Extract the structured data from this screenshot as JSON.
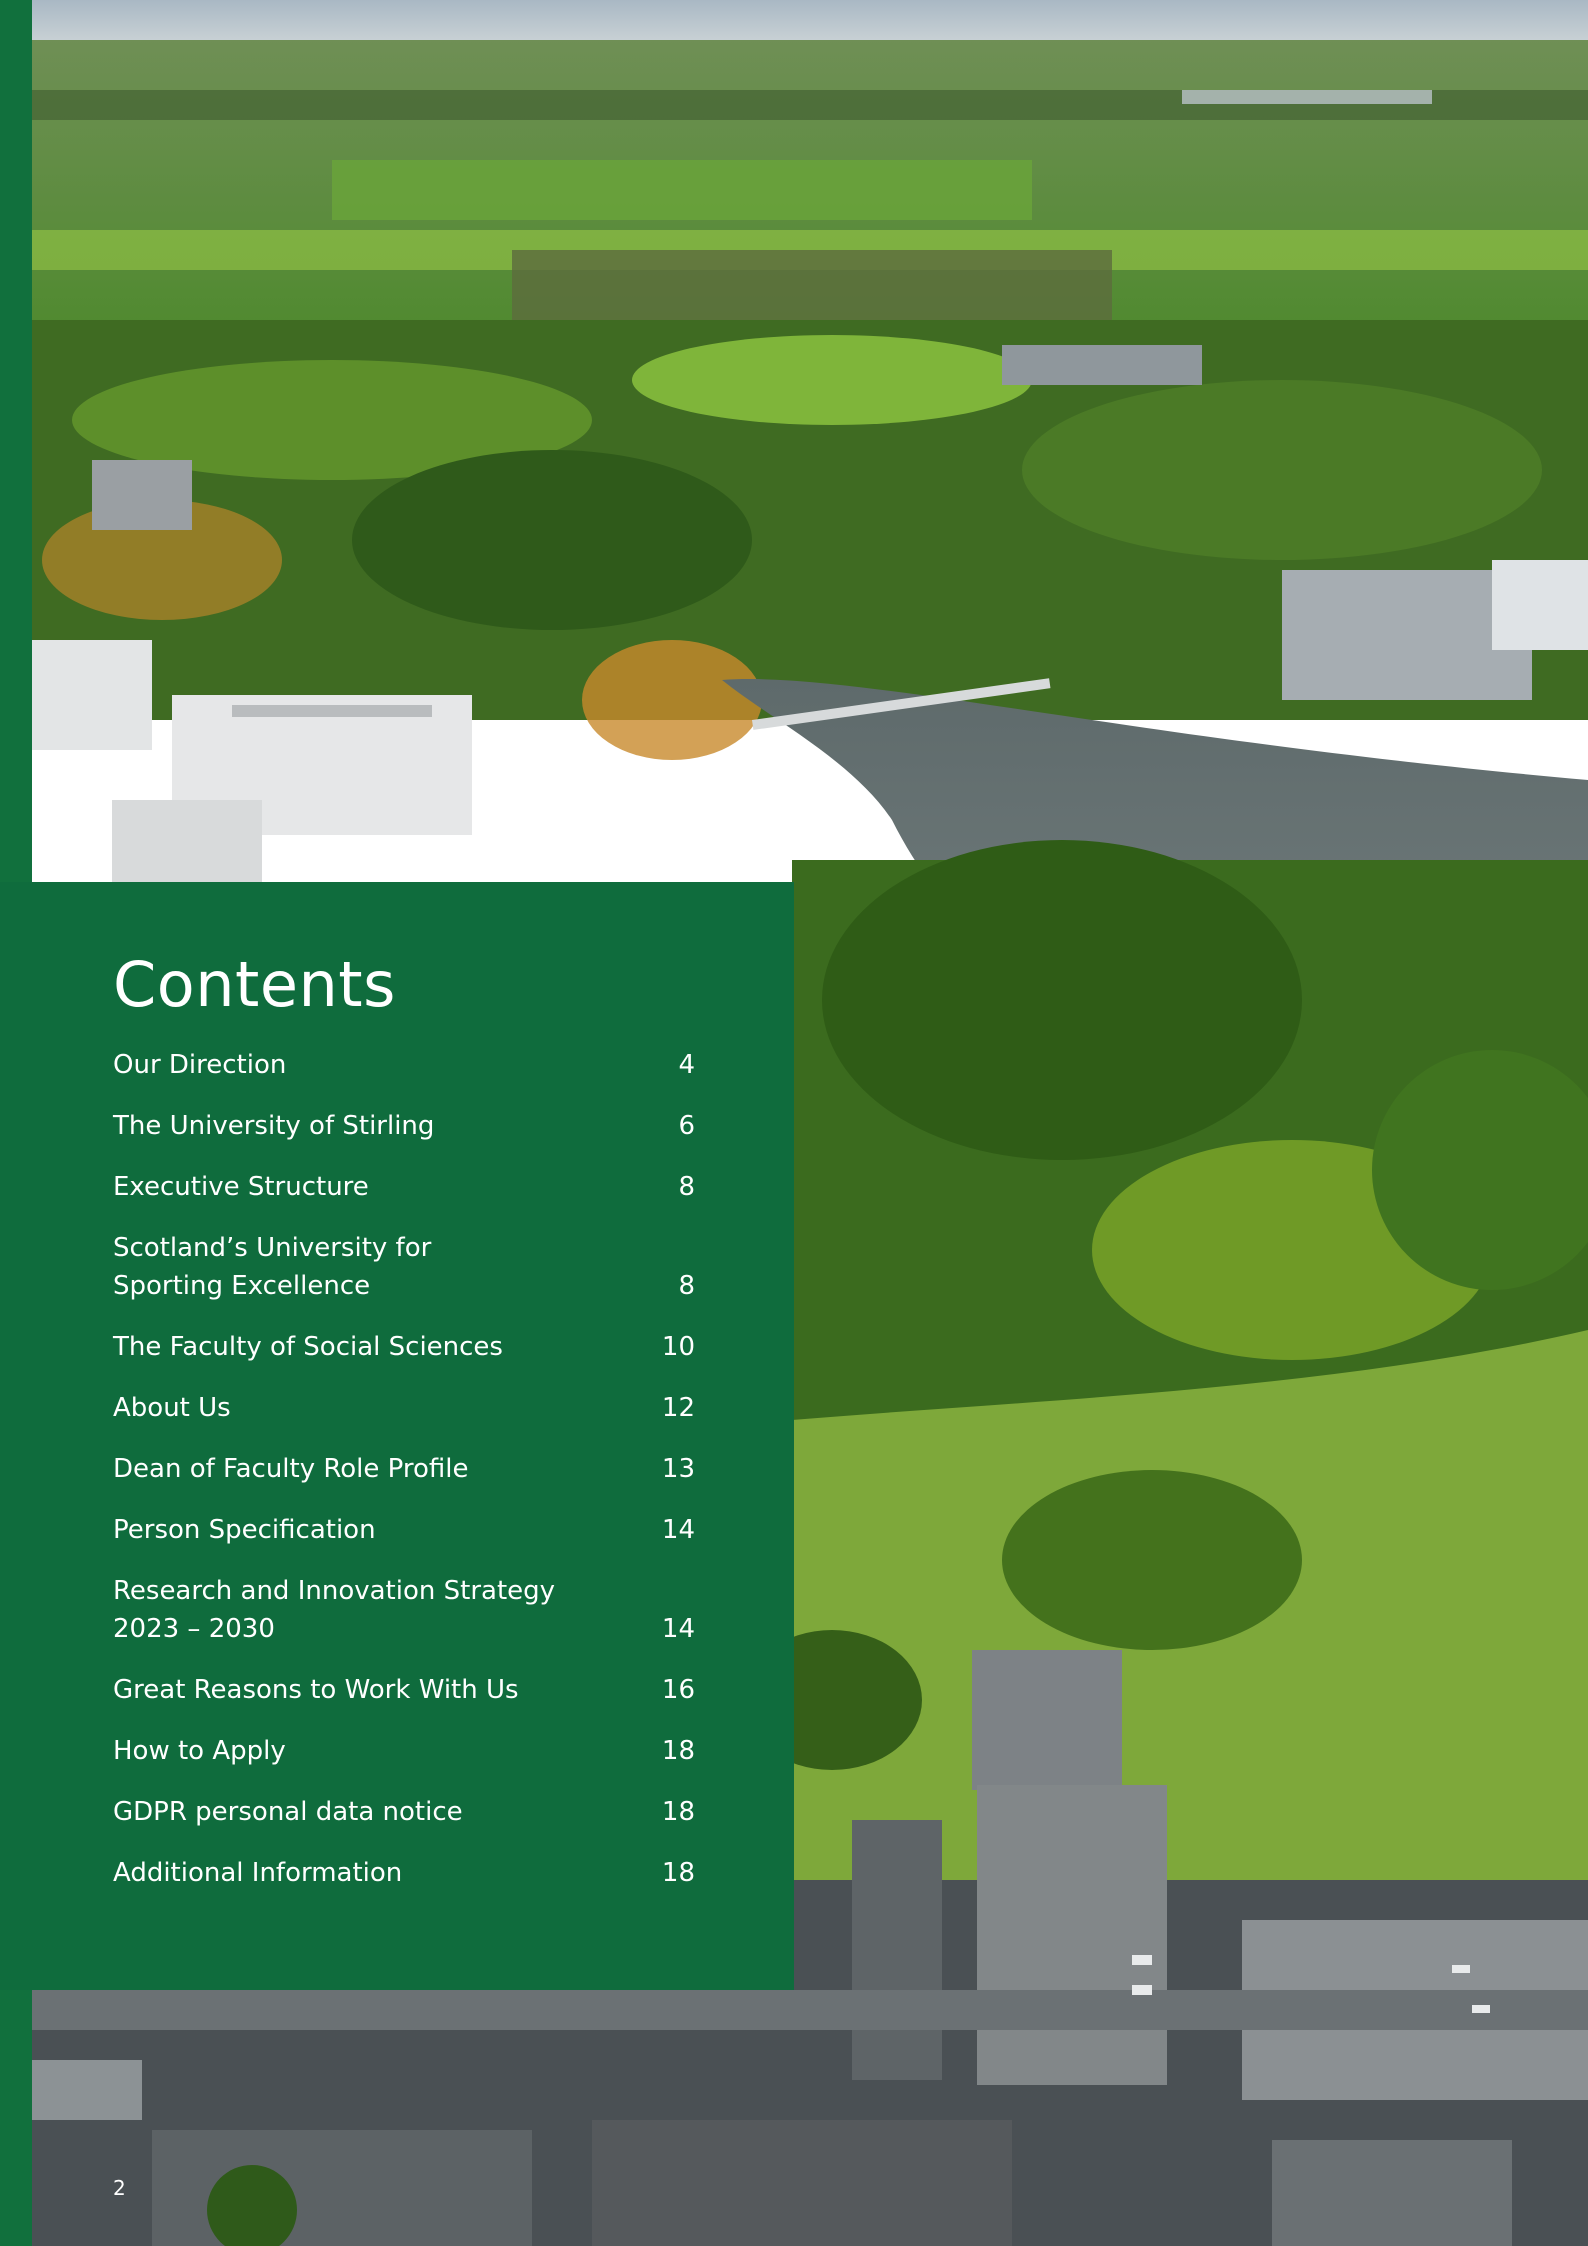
{
  "contents": {
    "title": "Contents",
    "items": [
      {
        "label": "Our Direction",
        "page": "4"
      },
      {
        "label": "The University of Stirling",
        "page": "6"
      },
      {
        "label": "Executive Structure",
        "page": "8"
      },
      {
        "label": "Scotland’s University for\nSporting Excellence",
        "page": "8"
      },
      {
        "label": "The Faculty of Social Sciences",
        "page": "10"
      },
      {
        "label": "About Us",
        "page": "12"
      },
      {
        "label": "Dean of Faculty Role Profile",
        "page": "13"
      },
      {
        "label": "Person Specification",
        "page": "14"
      },
      {
        "label": "Research and Innovation Strategy\n2023 – 2030",
        "page": "14"
      },
      {
        "label": "Great Reasons to Work With Us",
        "page": "16"
      },
      {
        "label": "How to Apply",
        "page": "18"
      },
      {
        "label": "GDPR personal data notice",
        "page": "18"
      },
      {
        "label": "Additional Information",
        "page": "18"
      }
    ]
  },
  "footer": {
    "page_number": "2"
  },
  "colors": {
    "brand_green": "#0f6c3d"
  }
}
